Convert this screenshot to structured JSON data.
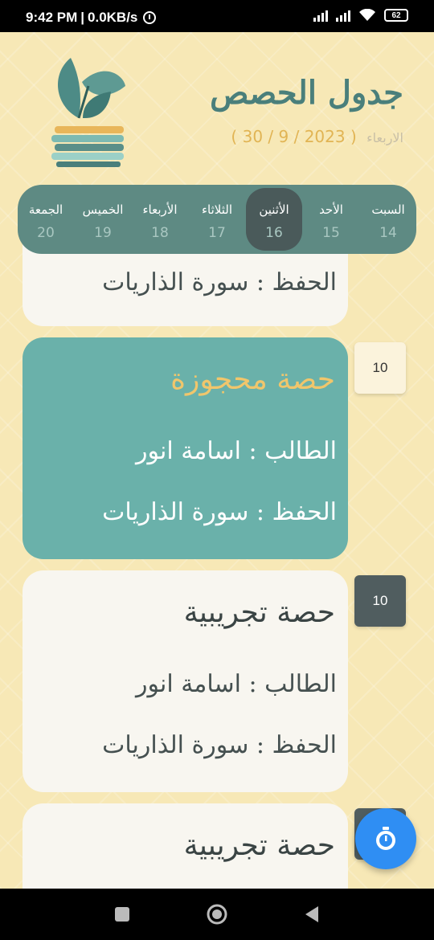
{
  "status_bar": {
    "time": "9:42 PM",
    "separator": "|",
    "speed": "0.0KB/s",
    "battery": "62"
  },
  "header": {
    "title": "جدول الحصص",
    "weekday": "الاربعاء",
    "date": "( 2023 / 9 / 30 )"
  },
  "day_tabs": [
    {
      "name": "السبت",
      "num": "14"
    },
    {
      "name": "الأحد",
      "num": "15"
    },
    {
      "name": "الأثنين",
      "num": "16"
    },
    {
      "name": "الثلاثاء",
      "num": "17"
    },
    {
      "name": "الأربعاء",
      "num": "18"
    },
    {
      "name": "الخميس",
      "num": "19"
    },
    {
      "name": "الجمعة",
      "num": "20"
    }
  ],
  "active_day_index": 2,
  "lessons": [
    {
      "memorization": "الحفظ : سورة الذاريات"
    },
    {
      "badge": "10",
      "title": "حصة محجوزة",
      "student": "الطالب  :  اسامة انور",
      "memorization": "الحفظ : سورة الذاريات",
      "status": "booked"
    },
    {
      "badge": "10",
      "title": "حصة تجريبية",
      "student": "الطالب  :  اسامة انور",
      "memorization": "الحفظ : سورة الذاريات",
      "status": "trial"
    },
    {
      "title": "حصة تجريبية",
      "status": "trial"
    }
  ],
  "fab": {
    "icon": "stopwatch-icon"
  },
  "nav": {
    "icons": [
      "recents-square-icon",
      "home-circle-icon",
      "back-triangle-icon"
    ]
  },
  "colors": {
    "background": "#f7e8b6",
    "primary": "#5e8a83",
    "booked_card": "#6ab1aa",
    "accent": "#e1b454",
    "fab": "#2f8ef3"
  }
}
